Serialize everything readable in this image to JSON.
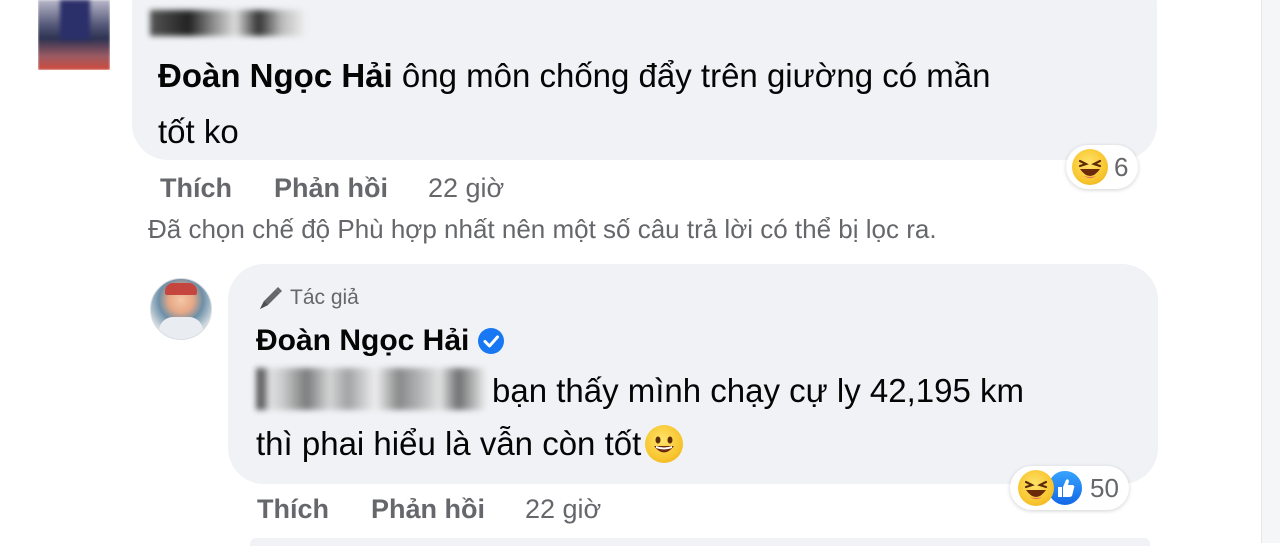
{
  "comment1": {
    "author": "Đoàn Ngọc Hải",
    "text_line1": " ông môn chống đẩy trên giường có mần",
    "text_line2": "tốt ko",
    "actions": {
      "like": "Thích",
      "reply": "Phản hồi",
      "time": "22 giờ"
    },
    "reaction_count": "6",
    "reaction_icon": "haha-emoji"
  },
  "filter_notice": "Đã chọn chế độ Phù hợp nhất nên một số câu trả lời có thể bị lọc ra.",
  "reply1": {
    "badge": "Tác giả",
    "author": "Đoàn Ngọc Hải",
    "verified_icon": "verified-badge-icon",
    "text_line1_visible": "bạn thấy mình chạy cự ly 42,195 km",
    "text_line2": "thì phai hiểu là vẫn còn tốt",
    "actions": {
      "like": "Thích",
      "reply": "Phản hồi",
      "time": "22 giờ"
    },
    "reaction_count": "50",
    "reaction_icons": [
      "haha-emoji",
      "like-icon"
    ]
  },
  "colors": {
    "bubble": "#f0f2f5",
    "text": "#050505",
    "secondary": "#65676b",
    "verified": "#1877f2"
  }
}
